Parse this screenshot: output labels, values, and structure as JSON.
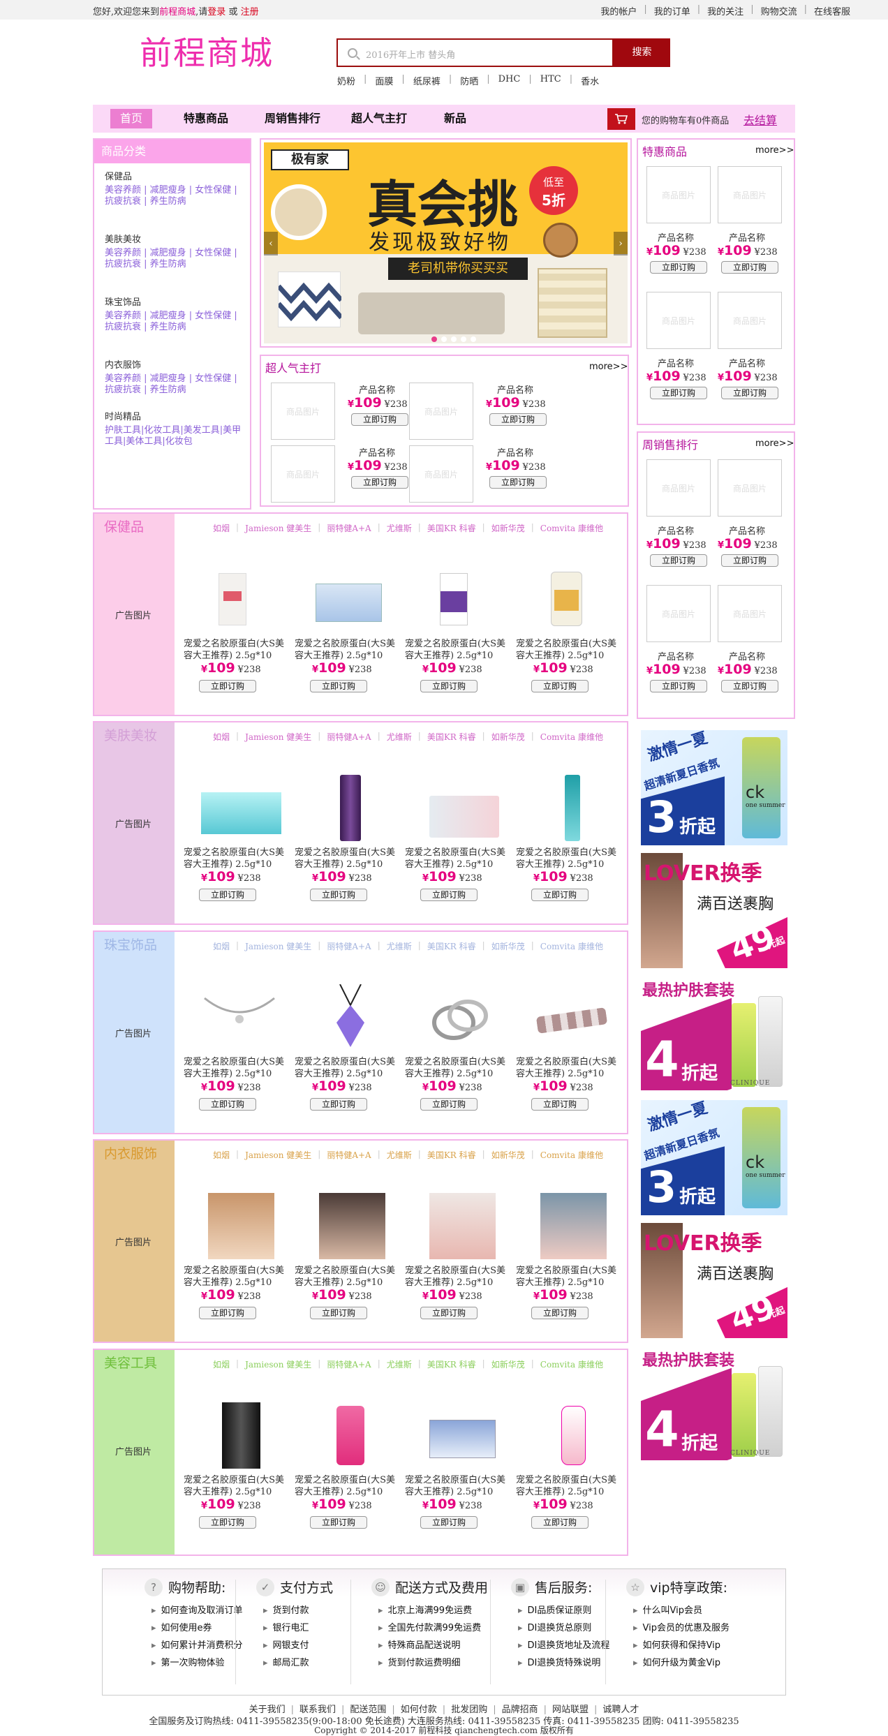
{
  "topbar": {
    "greet_pre": "您好,欢迎您来到",
    "site_name": "前程商城",
    "greet_mid": ",请",
    "login": "登录",
    "or": "或",
    "register": "注册",
    "links": [
      "我的帐户",
      "我的订单",
      "我的关注",
      "购物交流",
      "在线客服"
    ]
  },
  "header": {
    "logo": "前程商城",
    "search_placeholder": "2016开年上市 替头角",
    "search_button": "搜索",
    "hot_words": [
      "奶粉",
      "面膜",
      "纸尿裤",
      "防晒",
      "DHC",
      "HTC",
      "香水"
    ]
  },
  "nav": {
    "items": [
      "首页",
      "特惠商品",
      "周销售排行",
      "超人气主打",
      "新品"
    ],
    "cart_text": "您的购物车有0件商品",
    "checkout": "去结算"
  },
  "categories": {
    "title": "商品分类",
    "groups": [
      {
        "title": "保健品",
        "links": "美容养颜 | 减肥瘦身 | 女性保健 | 抗疲抗衰 | 养生防病"
      },
      {
        "title": "美肤美妆",
        "links": "美容养颜 | 减肥瘦身 | 女性保健 | 抗疲抗衰 | 养生防病"
      },
      {
        "title": "珠宝饰品",
        "links": "美容养颜 | 减肥瘦身 | 女性保健 | 抗疲抗衰 | 养生防病"
      },
      {
        "title": "内衣服饰",
        "links": "美容养颜 | 减肥瘦身 | 女性保健 | 抗疲抗衰 | 养生防病"
      },
      {
        "title": "时尚精品",
        "links": "护肤工具|化妆工具|美发工具|美甲工具|美体工具|化妆包"
      }
    ]
  },
  "banner": {
    "brand": "极有家",
    "headline": "真会挑",
    "sub": "发现极致好物",
    "badge1": "低至",
    "badge2": "5折",
    "ribbon": "老司机带你买买买"
  },
  "product": {
    "placeholder": "商品图片",
    "name": "产品名称",
    "currency": "¥",
    "price": "109",
    "old_price": "¥238",
    "order": "立即订购",
    "desc": "宠爱之名胶原蛋白(大S美容大王推荐) 2.5g*10",
    "ad_text": "广告图片",
    "more": "more>>"
  },
  "boxes": {
    "hot": "超人气主打",
    "special": "特惠商品",
    "weekly": "周销售排行"
  },
  "brands": [
    "如烟",
    "Jamieson 健美生",
    "丽特健A+A",
    "尤维斯",
    "美国KR 科睿",
    "如新华茂",
    "Comvita 康维他"
  ],
  "sections": [
    {
      "title": "保健品",
      "title_color": "#e96bc3",
      "side_color": "#fccde9",
      "brand_color": "#d067c7"
    },
    {
      "title": "美肤美妆",
      "title_color": "#d39fd6",
      "side_color": "#e8c6e6",
      "brand_color": "#d067c7"
    },
    {
      "title": "珠宝饰品",
      "title_color": "#9fb7e6",
      "side_color": "#cfe2fb",
      "brand_color": "#a4b4de"
    },
    {
      "title": "内衣服饰",
      "title_color": "#d99a2f",
      "side_color": "#e6c690",
      "brand_color": "#d9a24a"
    },
    {
      "title": "美容工具",
      "title_color": "#6fbf3b",
      "side_color": "#bfeaa3",
      "brand_color": "#8ccf5d"
    }
  ],
  "ads": [
    {
      "l1": "激情一夏",
      "l2": "超清新夏日香氛",
      "big": "3",
      "unit": "折起",
      "brand": "ck",
      "sub": "one summer"
    },
    {
      "l1": "LOVER换季",
      "l2": "满百送裹胸",
      "big": "49",
      "unit": "元起"
    },
    {
      "l1": "最热护肤套装",
      "big": "4",
      "unit": "折起",
      "brand": "CLINIQUE"
    },
    {
      "l1": "激情一夏",
      "l2": "超清新夏日香氛",
      "big": "3",
      "unit": "折起",
      "brand": "ck",
      "sub": "one summer"
    },
    {
      "l1": "LOVER换季",
      "l2": "满百送裹胸",
      "big": "49",
      "unit": "元起"
    },
    {
      "l1": "最热护肤套装",
      "big": "4",
      "unit": "折起",
      "brand": "CLINIQUE"
    }
  ],
  "footer": {
    "cols": [
      {
        "title": "购物帮助:",
        "items": [
          "如何查询及取消订单",
          "如何使用e券",
          "如何累计并消费积分",
          "第一次购物体验"
        ]
      },
      {
        "title": "支付方式",
        "items": [
          "货到付款",
          "银行电汇",
          "网银支付",
          "邮局汇款"
        ]
      },
      {
        "title": "配送方式及费用",
        "items": [
          "北京上海满99免运费",
          "全国先付款满99免运费",
          "特殊商品配送说明",
          "货到付款运费明细"
        ]
      },
      {
        "title": "售后服务:",
        "items": [
          "DI品质保证原则",
          "DI退换货总原则",
          "DI退换货地址及流程",
          "DI退换货特殊说明"
        ]
      },
      {
        "title": "vip特享政策:",
        "items": [
          "什么叫Vip会员",
          "Vip会员的优惠及服务",
          "如何获得和保持Vip",
          "如何升级为黄金Vip"
        ]
      }
    ],
    "links": [
      "关于我们",
      "联系我们",
      "配送范围",
      "如何付款",
      "批发团购",
      "品牌招商",
      "网站联盟",
      "诚聘人才"
    ],
    "hotline": "全国服务及订购热线: 0411-39558235(9:00-18:00 免长途费)   大连服务热线: 0411-39558235  传真: 0411-39558235   团购: 0411-39558235",
    "copyright": "Copyright © 2014-2017  前程科技 qianchengtech.com 版权所有"
  }
}
